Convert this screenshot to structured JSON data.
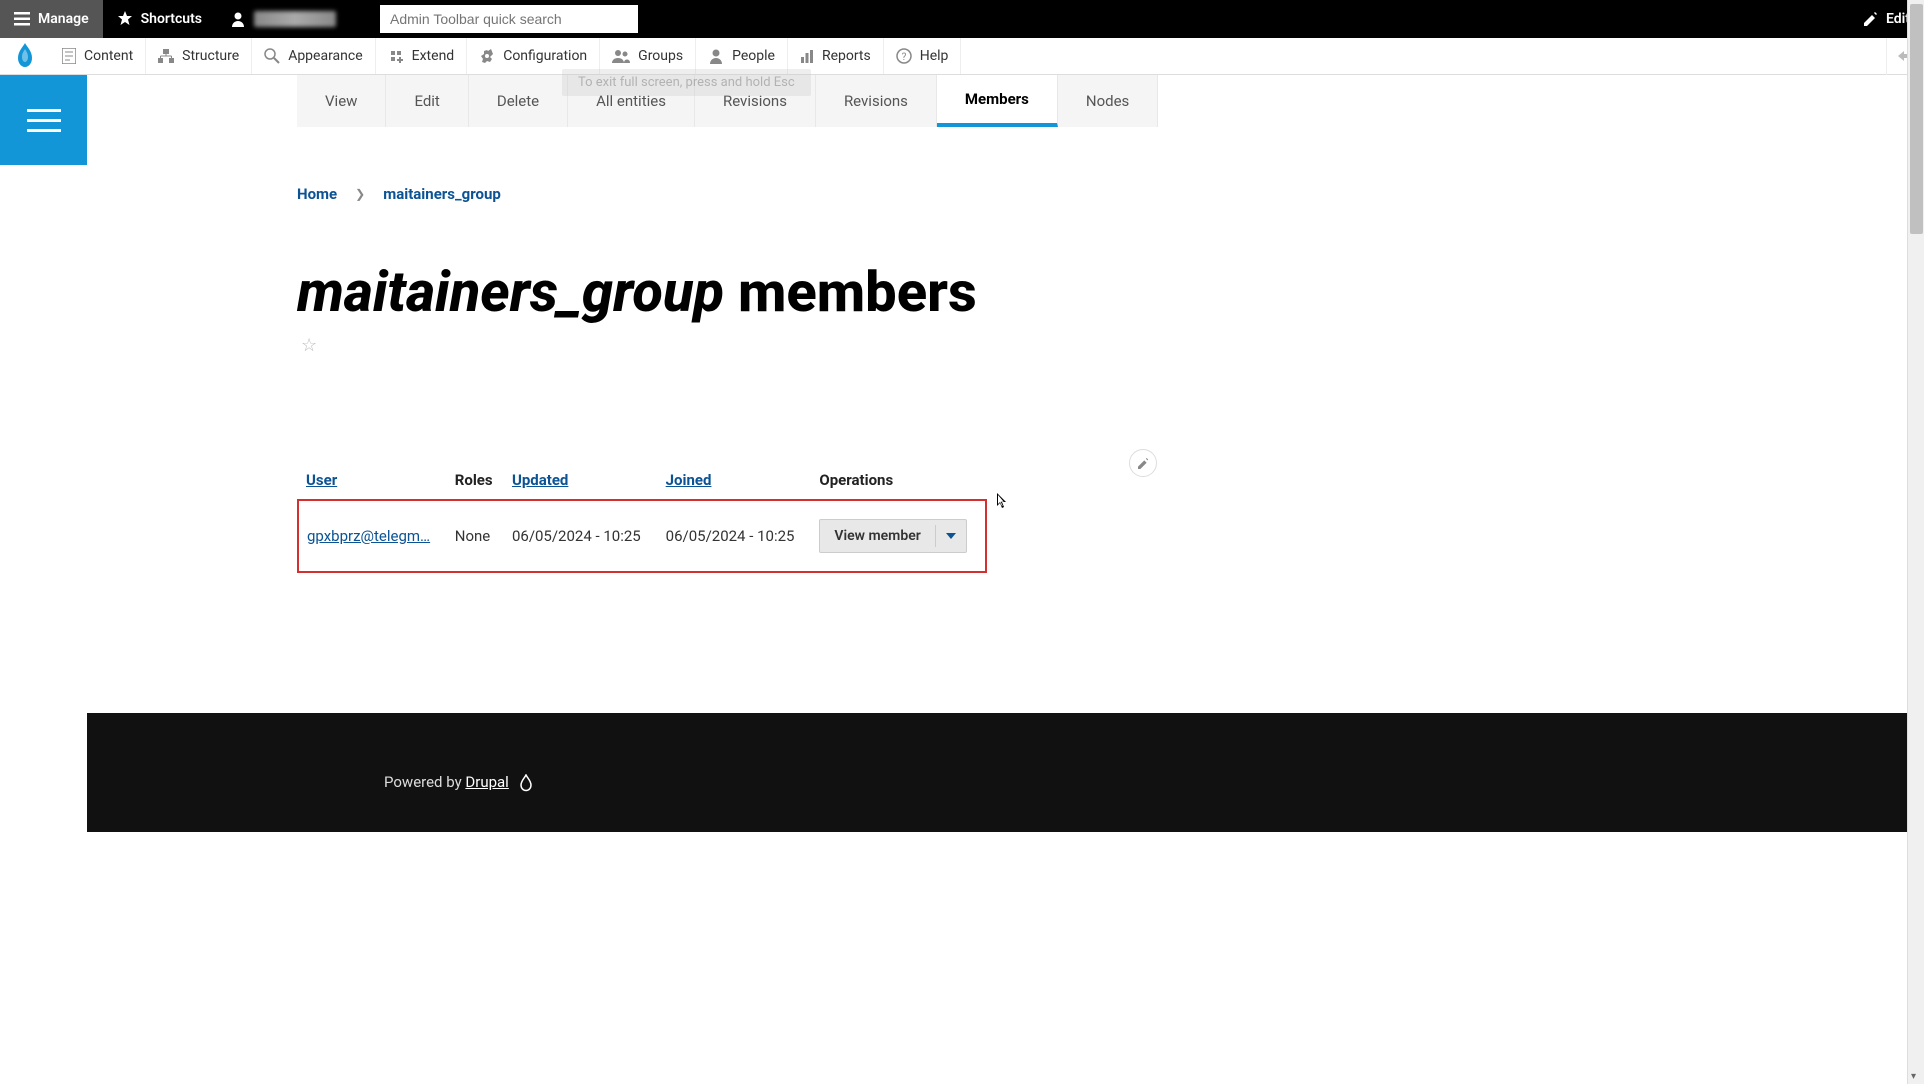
{
  "top_toolbar": {
    "manage": "Manage",
    "shortcuts": "Shortcuts",
    "edit": "Edit",
    "search_placeholder": "Admin Toolbar quick search"
  },
  "admin_menu": {
    "content": "Content",
    "structure": "Structure",
    "appearance": "Appearance",
    "extend": "Extend",
    "configuration": "Configuration",
    "groups": "Groups",
    "people": "People",
    "reports": "Reports",
    "help": "Help"
  },
  "ghost_tooltip": "To exit full screen, press and hold Esc",
  "tabs": {
    "view": "View",
    "edit": "Edit",
    "delete": "Delete",
    "all_entities": "All entities",
    "revisions1": "Revisions",
    "revisions2": "Revisions",
    "members": "Members",
    "nodes": "Nodes"
  },
  "breadcrumb": {
    "home": "Home",
    "current": "maitainers_group"
  },
  "title": {
    "group": "maitainers_group",
    "suffix": " members"
  },
  "table": {
    "headers": {
      "user": "User",
      "roles": "Roles",
      "updated": "Updated",
      "joined": "Joined",
      "operations": "Operations"
    },
    "rows": [
      {
        "user": "gpxbprz@telegm…",
        "roles": "None",
        "updated": "06/05/2024 - 10:25",
        "joined": "06/05/2024 - 10:25",
        "operation": "View member"
      }
    ]
  },
  "footer": {
    "powered_by": "Powered by ",
    "drupal": "Drupal"
  }
}
